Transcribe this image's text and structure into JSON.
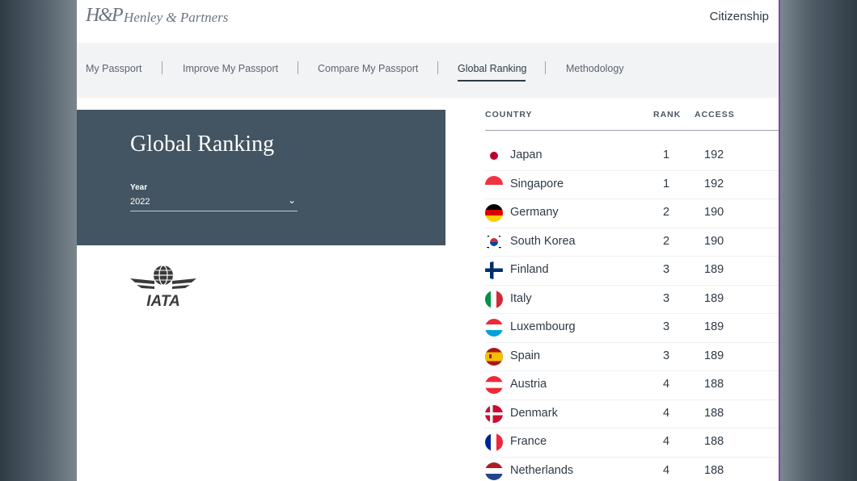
{
  "brand": {
    "mark": "H&P",
    "name": "Henley & Partners"
  },
  "header": {
    "top_link": "Citizenship"
  },
  "subnav": {
    "items": [
      {
        "label": "My Passport",
        "active": false
      },
      {
        "label": "Improve My Passport",
        "active": false
      },
      {
        "label": "Compare My Passport",
        "active": false
      },
      {
        "label": "Global Ranking",
        "active": true
      },
      {
        "label": "Methodology",
        "active": false
      }
    ]
  },
  "panel": {
    "title": "Global Ranking",
    "year_label": "Year",
    "year_value": "2022"
  },
  "logo_iata": {
    "text": "IATA"
  },
  "table": {
    "headers": {
      "country": "COUNTRY",
      "rank": "RANK",
      "access": "ACCESS"
    },
    "rows": [
      {
        "country": "Japan",
        "rank": "1",
        "access": "192",
        "flag": "jp"
      },
      {
        "country": "Singapore",
        "rank": "1",
        "access": "192",
        "flag": "sg"
      },
      {
        "country": "Germany",
        "rank": "2",
        "access": "190",
        "flag": "de"
      },
      {
        "country": "South Korea",
        "rank": "2",
        "access": "190",
        "flag": "kr"
      },
      {
        "country": "Finland",
        "rank": "3",
        "access": "189",
        "flag": "fi"
      },
      {
        "country": "Italy",
        "rank": "3",
        "access": "189",
        "flag": "it"
      },
      {
        "country": "Luxembourg",
        "rank": "3",
        "access": "189",
        "flag": "lu"
      },
      {
        "country": "Spain",
        "rank": "3",
        "access": "189",
        "flag": "es"
      },
      {
        "country": "Austria",
        "rank": "4",
        "access": "188",
        "flag": "at"
      },
      {
        "country": "Denmark",
        "rank": "4",
        "access": "188",
        "flag": "dk"
      },
      {
        "country": "France",
        "rank": "4",
        "access": "188",
        "flag": "fr"
      },
      {
        "country": "Netherlands",
        "rank": "4",
        "access": "188",
        "flag": "nl"
      }
    ]
  },
  "colors": {
    "panel": "#435462",
    "text": "#2e3a46",
    "accent_frame": "#8a3fb0"
  }
}
